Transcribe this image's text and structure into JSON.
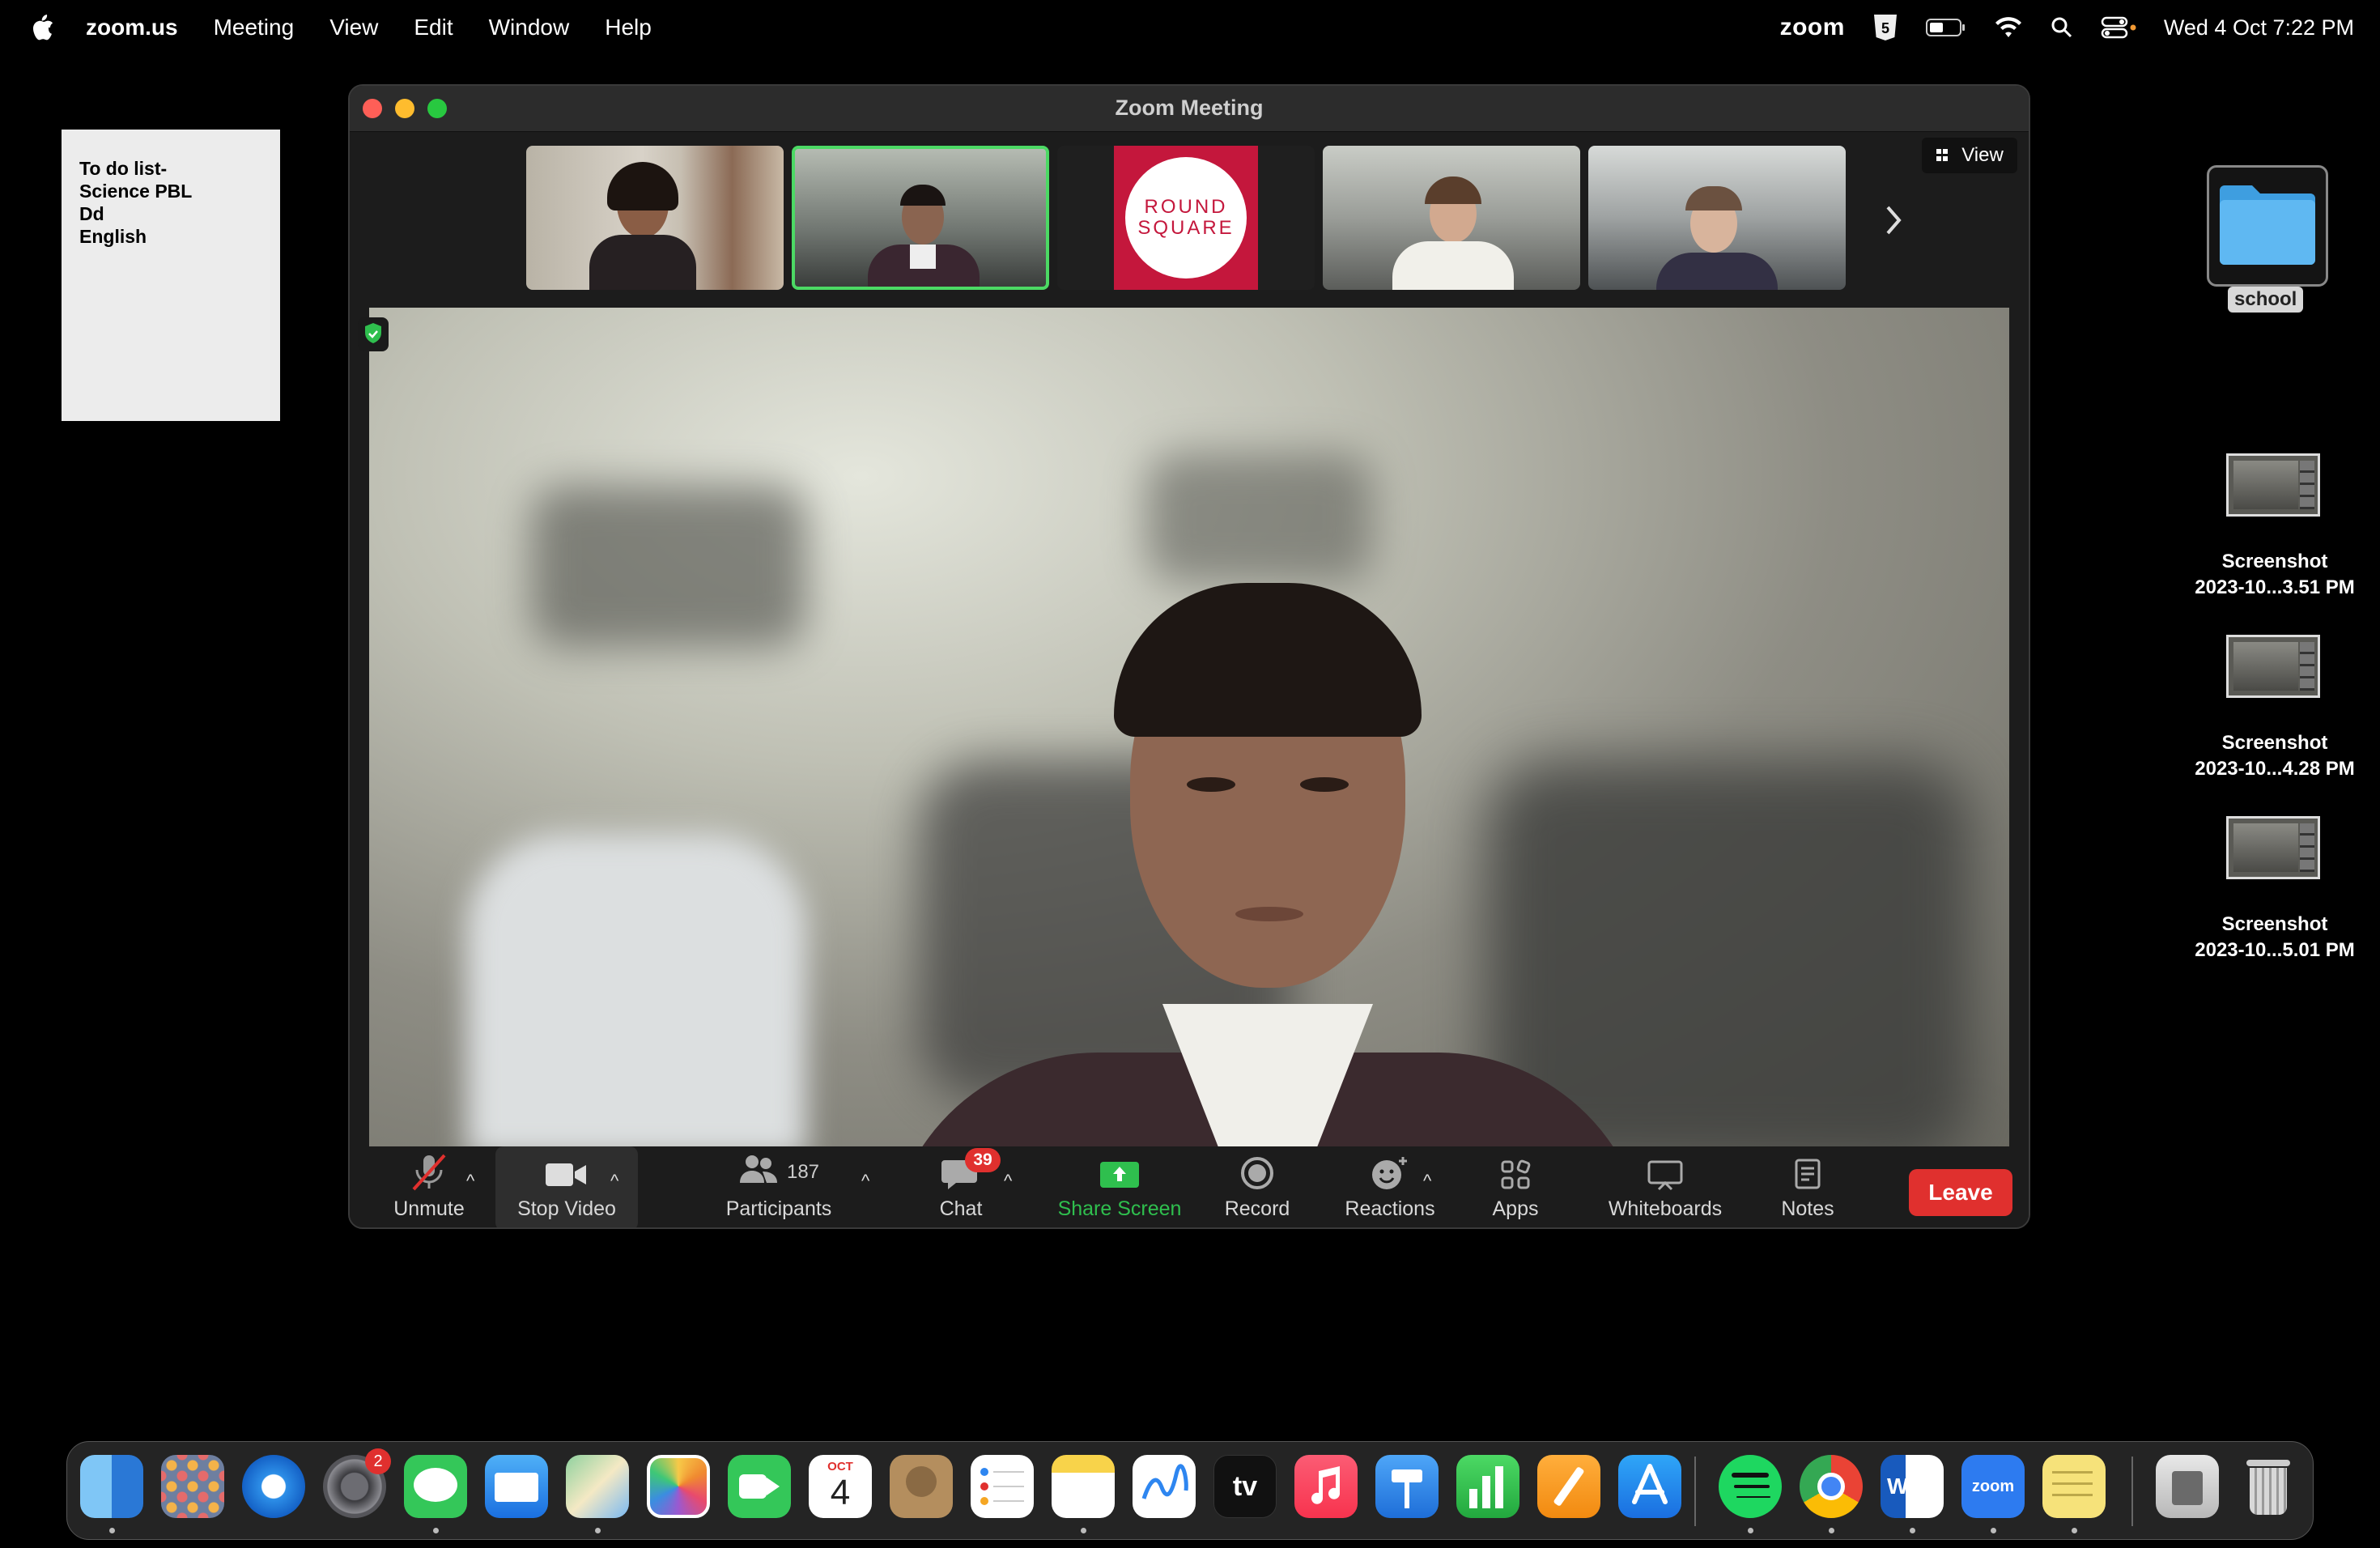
{
  "menubar": {
    "app_name": "zoom.us",
    "items": [
      "Meeting",
      "View",
      "Edit",
      "Window",
      "Help"
    ],
    "right_app": "zoom",
    "datetime": "Wed 4 Oct  7:22 PM"
  },
  "sticky_note": {
    "lines": [
      "To do list-",
      "Science PBL",
      "Dd",
      "English"
    ]
  },
  "desktop": {
    "folder_label": "school",
    "screenshots": [
      {
        "line1": "Screenshot",
        "line2": "2023-10...3.51 PM"
      },
      {
        "line1": "Screenshot",
        "line2": "2023-10...4.28 PM"
      },
      {
        "line1": "Screenshot",
        "line2": "2023-10...5.01 PM"
      }
    ]
  },
  "window": {
    "title": "Zoom Meeting",
    "view_label": "View",
    "round_square": {
      "line1": "ROUND",
      "line2": "SQUARE"
    }
  },
  "toolbar": {
    "unmute": "Unmute",
    "stop_video": "Stop Video",
    "participants": "Participants",
    "participant_count": "187",
    "chat": "Chat",
    "chat_badge": "39",
    "share_screen": "Share Screen",
    "record": "Record",
    "reactions": "Reactions",
    "apps": "Apps",
    "whiteboards": "Whiteboards",
    "notes": "Notes",
    "leave": "Leave"
  },
  "dock": {
    "settings_badge": "2",
    "calendar_month": "OCT",
    "calendar_day": "4",
    "appletv_label": "tv",
    "word_letter": "W",
    "zoom_label": "zoom"
  },
  "colors": {
    "leave_red": "#e0302e",
    "share_green": "#2fbf4e",
    "active_speaker_border": "#4cd964",
    "folder_blue": "#5fb8f2",
    "round_square_red": "#c4173c"
  }
}
